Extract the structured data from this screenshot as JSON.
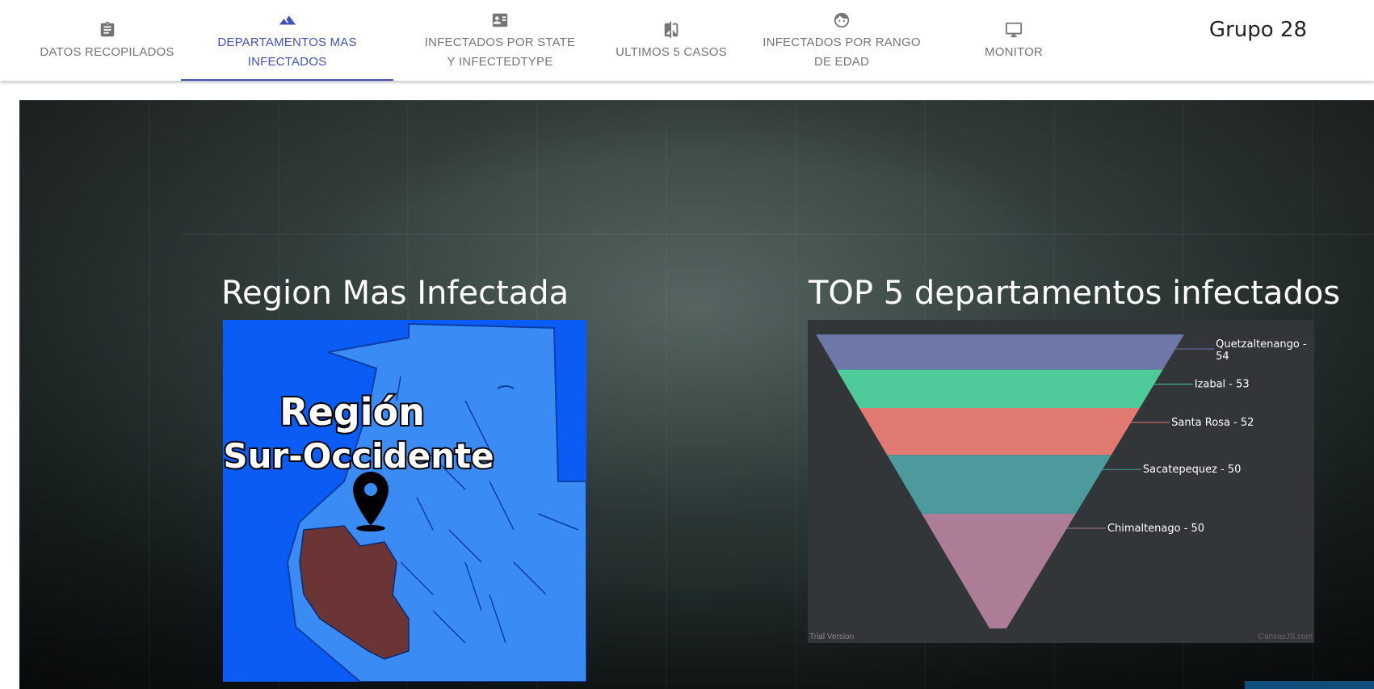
{
  "tabs": [
    {
      "label": "DATOS RECOPILADOS",
      "icon": "clipboard-icon",
      "active": false
    },
    {
      "label": "DEPARTAMENTOS MAS INFECTADOS",
      "icon": "terrain-icon",
      "active": true
    },
    {
      "label": "INFECTADOS POR STATE Y INFECTEDTYPE",
      "icon": "id-card-icon",
      "active": false
    },
    {
      "label": "ULTIMOS 5 CASOS",
      "icon": "compare-icon",
      "active": false
    },
    {
      "label": "INFECTADOS POR RANGO DE EDAD",
      "icon": "face-icon",
      "active": false
    },
    {
      "label": "MONITOR",
      "icon": "monitor-icon",
      "active": false
    }
  ],
  "brand": "Grupo 28",
  "left_section": {
    "title": "Region Mas Infectada",
    "map_text_line1": "Región",
    "map_text_line2": "Sur-Occidente"
  },
  "right_section": {
    "title": "TOP 5 departamentos infectados",
    "trial_text": "Trial Version",
    "credit_text": "CanvasJS.com"
  },
  "chart_data": {
    "type": "funnel",
    "categories": [
      "Quetzaltenango",
      "Izabal",
      "Santa Rosa",
      "Sacatepequez",
      "Chimaltenago"
    ],
    "values": [
      54,
      53,
      52,
      50,
      50
    ],
    "labels": [
      "Quetzaltenango - 54",
      "Izabal - 53",
      "Santa Rosa - 52",
      "Sacatepequez - 50",
      "Chimaltenago - 50"
    ],
    "colors": [
      "#6d77a8",
      "#4fcb9b",
      "#e07a70",
      "#4c9a9c",
      "#ad7d98"
    ]
  },
  "colors": {
    "accent": "#3f51b5",
    "tab_text": "#757575",
    "map_bg": "#0a5cf5",
    "region_fill": "#6b3535"
  }
}
